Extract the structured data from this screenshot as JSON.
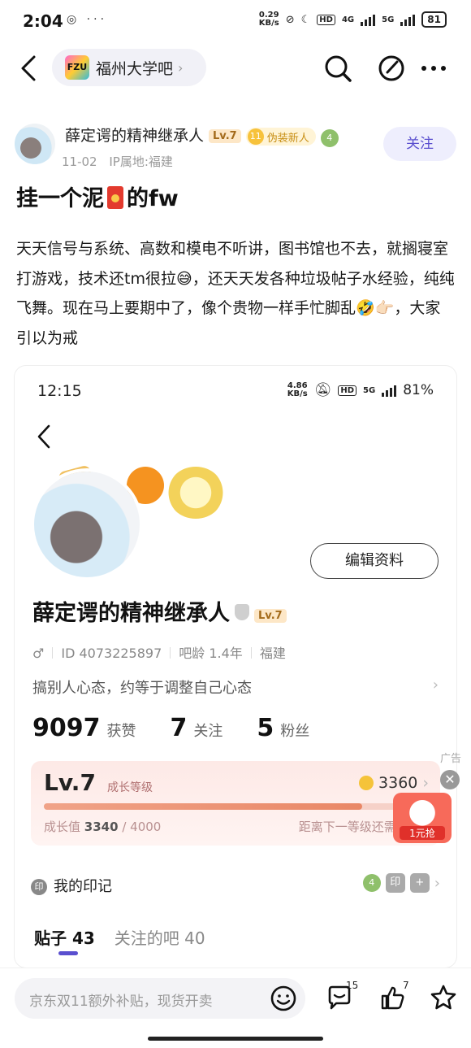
{
  "status_bar": {
    "time": "2:04",
    "icons": "◎ ···",
    "net_speed_value": "0.29",
    "net_speed_unit": "KB/s",
    "hd": "HD",
    "sig1": "4G",
    "sig2": "5G",
    "battery": "81"
  },
  "topbar": {
    "forum_name": "福州大学吧",
    "logo_text": "FZU"
  },
  "author": {
    "name": "薛定谔的精神继承人",
    "level": "Lv.7",
    "coin_level": "11",
    "badge": "伪装新人",
    "leaf": "4",
    "date": "11-02",
    "ip": "IP属地:福建",
    "follow_label": "关注"
  },
  "post": {
    "title_before": "挂一个泥",
    "title_after": "的fw",
    "body": "天天信号与系统、高数和模电不听讲，图书馆也不去，就搁寝室打游戏，技术还tm很拉😅，还天天发各种垃圾帖子水经验，纯纯飞舞。现在马上要期中了，像个贵物一样手忙脚乱🤣👉🏻，大家引以为戒"
  },
  "screenshot": {
    "time": "12:15",
    "net_speed_value": "4.86",
    "net_speed_unit": "KB/s",
    "hd": "HD",
    "sig": "5G",
    "battery": "81%",
    "edit_label": "编辑资料",
    "name": "薛定谔的精神继承人",
    "level": "Lv.7",
    "gender": "♂",
    "id": "ID 4073225897",
    "bar_age": "吧龄 1.4年",
    "region": "福建",
    "signature": "搞别人心态，约等于调整自己心态",
    "stats": [
      {
        "num": "9097",
        "label": "获赞"
      },
      {
        "num": "7",
        "label": "关注"
      },
      {
        "num": "5",
        "label": "粉丝"
      }
    ],
    "level_card": {
      "level": "Lv.7",
      "subtitle": "成长等级",
      "coins": "3360",
      "growth_label": "成长值",
      "growth_current": "3340",
      "growth_total": "/ 4000",
      "progress": 0.835,
      "next_label": "距离下一等级还需 6"
    },
    "marks_label": "我的印记",
    "marks_icon": "印",
    "marks_leaf": "4",
    "marks_seal": "印",
    "marks_plus": "+",
    "tabs": [
      {
        "label": "贴子 43"
      },
      {
        "label": "关注的吧 40"
      }
    ]
  },
  "ad": {
    "label": "广告",
    "close": "✕",
    "promo": "1元抢"
  },
  "bottom": {
    "placeholder": "京东双11额外补贴，现货开卖",
    "comment_count": "15",
    "like_count": "7"
  }
}
